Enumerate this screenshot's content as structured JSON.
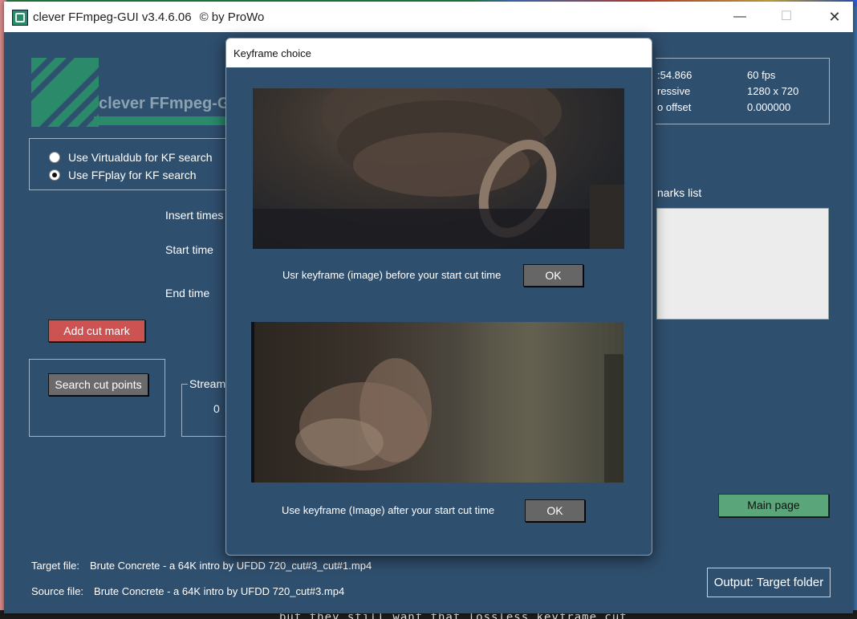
{
  "window": {
    "title": "clever FFmpeg-GUI v3.4.6.06",
    "copyright": "© by ProWo",
    "minimize_glyph": "—",
    "maximize_glyph": "☐",
    "close_glyph": "✕"
  },
  "logo": {
    "text": "clever FFmpeg-G"
  },
  "kf_search": {
    "options": [
      {
        "label": "Use Virtualdub for KF search",
        "selected": false
      },
      {
        "label": "Use FFplay for KF search",
        "selected": true
      }
    ]
  },
  "labels": {
    "insert_times": "Insert times (",
    "start_time": "Start time",
    "end_time": "End time",
    "stream": "Stream",
    "stream_value": "0",
    "cutmarks_list": "narks list"
  },
  "buttons": {
    "add_cut_mark": "Add cut mark",
    "search_cut_points": "Search cut points",
    "main_page": "Main page",
    "output_target_folder": "Output: Target folder"
  },
  "info": {
    "duration_fragment": ":54.866",
    "fps": "60 fps",
    "scan_fragment": "ressive",
    "resolution": "1280 x 720",
    "offset_label_fragment": "o offset",
    "offset_value": "0.000000"
  },
  "files": {
    "target_label": "Target file:",
    "target_name": "Brute Concrete - a 64K intro by UFDD 720_cut#3_cut#1.mp4",
    "source_label": "Source file:",
    "source_name": "Brute Concrete - a 64K intro by UFDD 720_cut#3.mp4"
  },
  "dialog": {
    "title": "Keyframe choice",
    "before_label": "Usr keyframe (image) before your start cut time",
    "after_label": "Use keyframe (Image) after your start cut time",
    "ok_label": "OK"
  },
  "background_terminal": {
    "text": "but they still want that lossless keyframe cut"
  },
  "colors": {
    "app_bg": "#2f4f6e",
    "accent_green": "#2a8a6a",
    "add_cut_red": "#cd5353",
    "main_page_green": "#5aa57a"
  }
}
